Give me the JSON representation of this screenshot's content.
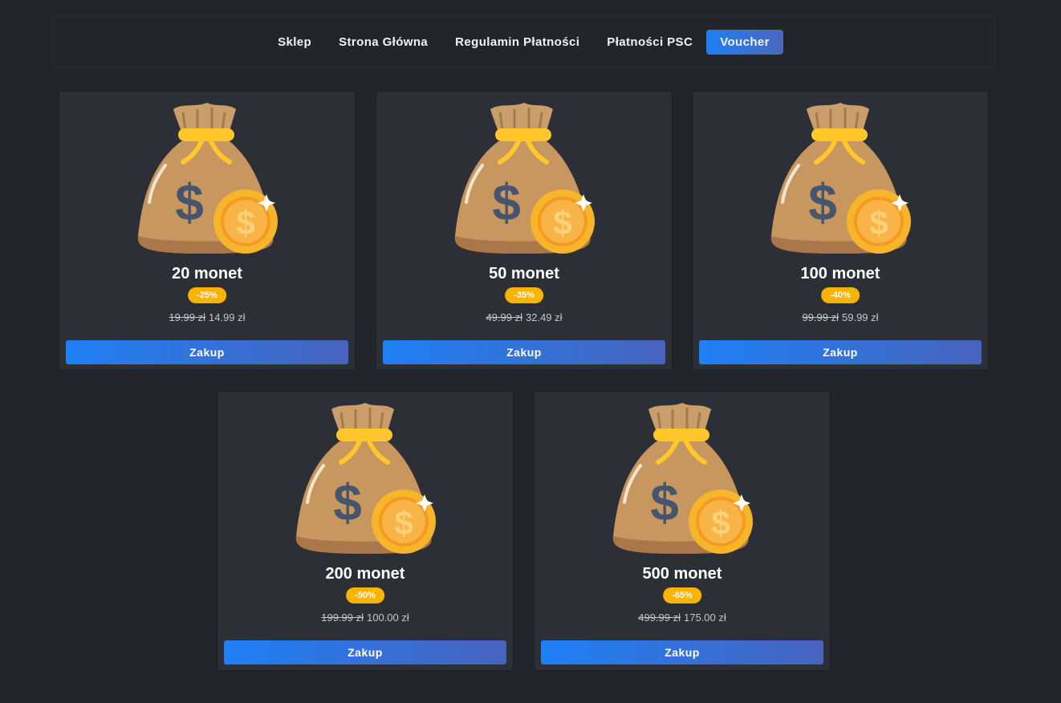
{
  "nav": {
    "items": [
      {
        "label": "Sklep",
        "active": false
      },
      {
        "label": "Strona Główna",
        "active": false
      },
      {
        "label": "Regulamin Płatności",
        "active": false
      },
      {
        "label": "Płatności PSC",
        "active": false
      },
      {
        "label": "Voucher",
        "active": true
      }
    ]
  },
  "products": [
    {
      "title": "20 monet",
      "discount": "-25%",
      "old_price": "19.99 zł",
      "price": "14.99 zł",
      "button": "Zakup",
      "icon": "money-bag-icon"
    },
    {
      "title": "50 monet",
      "discount": "-35%",
      "old_price": "49.99 zł",
      "price": "32.49 zł",
      "button": "Zakup",
      "icon": "money-bag-icon"
    },
    {
      "title": "100 monet",
      "discount": "-40%",
      "old_price": "99.99 zł",
      "price": "59.99 zł",
      "button": "Zakup",
      "icon": "money-bag-icon"
    },
    {
      "title": "200 monet",
      "discount": "-50%",
      "old_price": "199.99 zł",
      "price": "100.00 zł",
      "button": "Zakup",
      "icon": "money-bag-icon"
    },
    {
      "title": "500 monet",
      "discount": "-65%",
      "old_price": "499.99 zł",
      "price": "175.00 zł",
      "button": "Zakup",
      "icon": "money-bag-icon"
    }
  ],
  "colors": {
    "background": "#22252b",
    "card": "#2c2f36",
    "accent_start": "#1f80f5",
    "accent_end": "#4763bd",
    "badge": "#f8b400"
  }
}
